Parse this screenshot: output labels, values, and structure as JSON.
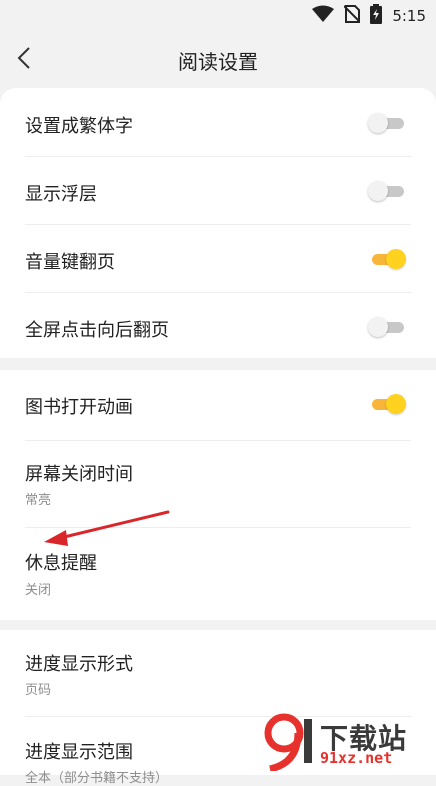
{
  "status": {
    "time": "5:15"
  },
  "header": {
    "title": "阅读设置"
  },
  "section1": [
    {
      "label": "设置成繁体字",
      "toggle": false
    },
    {
      "label": "显示浮层",
      "toggle": false
    },
    {
      "label": "音量键翻页",
      "toggle": true
    },
    {
      "label": "全屏点击向后翻页",
      "toggle": false
    }
  ],
  "section2": {
    "animation": {
      "label": "图书打开动画",
      "toggle": true
    },
    "screen_off": {
      "label": "屏幕关闭时间",
      "value": "常亮"
    },
    "rest_reminder": {
      "label": "休息提醒",
      "value": "关闭"
    }
  },
  "section3": {
    "progress_style": {
      "label": "进度显示形式",
      "value": "页码"
    },
    "progress_range": {
      "label": "进度显示范围",
      "value": "全本（部分书籍不支持）"
    }
  },
  "watermark": {
    "text": "下载站",
    "url": "91xz.net"
  },
  "colors": {
    "accent": "#ffd21f",
    "annotation_arrow": "#d9262b"
  }
}
